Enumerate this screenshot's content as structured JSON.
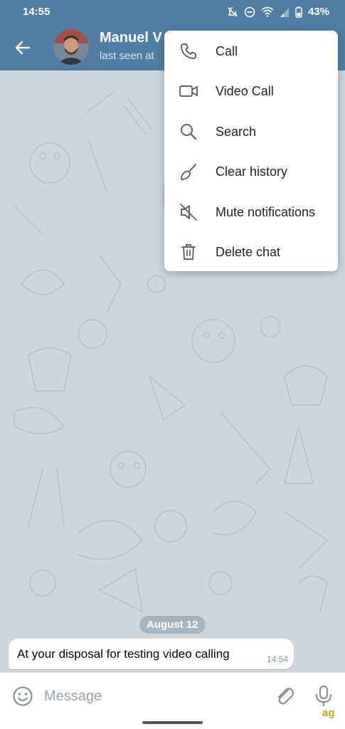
{
  "status_bar": {
    "time": "14:55",
    "battery": "43%"
  },
  "header": {
    "name": "Manuel V",
    "status": "last seen at "
  },
  "menu": {
    "items": [
      {
        "label": "Call",
        "icon": "phone-icon"
      },
      {
        "label": "Video Call",
        "icon": "video-camera-icon"
      },
      {
        "label": "Search",
        "icon": "search-icon"
      },
      {
        "label": "Clear history",
        "icon": "broom-icon"
      },
      {
        "label": "Mute notifications",
        "icon": "mute-icon"
      },
      {
        "label": "Delete chat",
        "icon": "trash-icon"
      }
    ]
  },
  "chat": {
    "date": "August 12",
    "messages": [
      {
        "text": "At your disposal for testing video calling",
        "time": "14:54"
      }
    ]
  },
  "composer": {
    "placeholder": "Message"
  },
  "watermark": "ag",
  "colors": {
    "header": "#517da2",
    "wallpaper": "#cdd6de",
    "bubble": "#ffffff"
  }
}
